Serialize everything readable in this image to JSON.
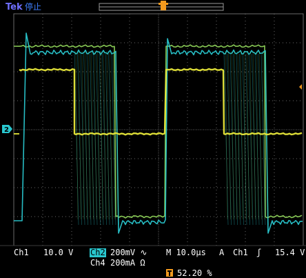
{
  "header": {
    "brand": "Tek",
    "run_state": "停止"
  },
  "markers": {
    "trigger_position": "T",
    "channel2_ground": "2"
  },
  "status_bar": {
    "ch1_label": "Ch1",
    "ch1_scale": "10.0 V",
    "ch2_label": "Ch2",
    "ch2_scale": "200mV ∿",
    "ch4_label": "Ch4",
    "ch4_scale": "200mA Ω",
    "timebase": "M 10.0μs",
    "trigger_mode": "A",
    "trigger_source": "Ch1",
    "trigger_slope": "ʃ",
    "trigger_level": "15.4 V",
    "trigger_percent": "52.20 %"
  },
  "colors": {
    "background": "#000000",
    "graticule": "#6a6a6a",
    "ch1_yellow": "#e8e83a",
    "ch2_cyan": "#29c7cf",
    "ch4_green": "#8fd45a",
    "trigger_orange": "#f39a1e",
    "status_bg": "#1a4f8a"
  },
  "icons": {
    "trigger": "trigger-t-icon",
    "level_arrow": "trigger-level-arrow-icon",
    "ground": "ch2-ground-marker-icon"
  }
}
